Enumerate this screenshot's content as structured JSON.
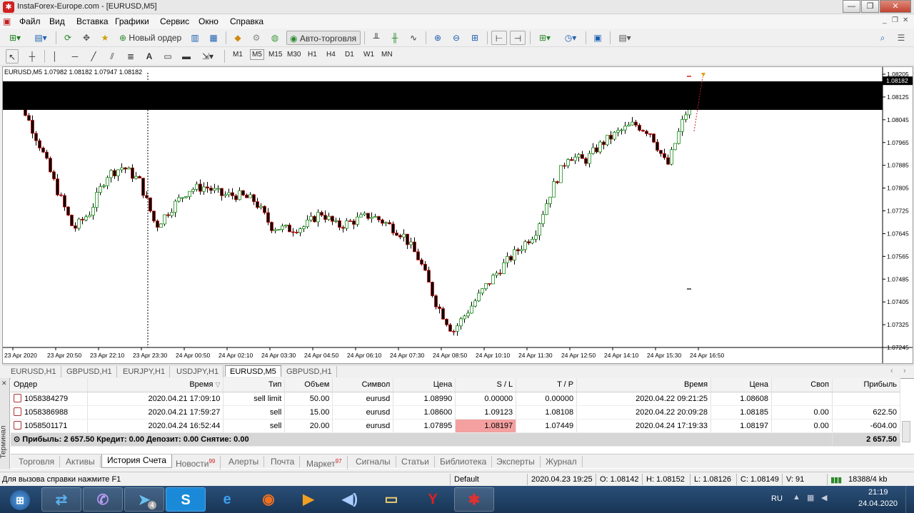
{
  "window": {
    "title": "InstaForex-Europe.com - [EURUSD,M5]",
    "controls": [
      "—",
      "❐",
      "✕"
    ]
  },
  "menu": [
    "Файл",
    "Вид",
    "Вставка",
    "Графики",
    "Сервис",
    "Окно",
    "Справка"
  ],
  "toolbar": {
    "new_order_label": "Новый ордер",
    "auto_trading_label": "Авто-торговля"
  },
  "timeframes": [
    "M1",
    "M5",
    "M15",
    "M30",
    "H1",
    "H4",
    "D1",
    "W1",
    "MN"
  ],
  "chart": {
    "legend": "EURUSD,M5  1.07982 1.08182 1.07947 1.08182",
    "price_label": "1.08182"
  },
  "chart_data": {
    "type": "candlestick",
    "symbol": "EURUSD",
    "timeframe": "M5",
    "ylim": [
      1.07245,
      1.08205
    ],
    "price_ticks": [
      "1.08205",
      "1.08125",
      "1.08045",
      "1.07965",
      "1.07885",
      "1.07805",
      "1.07725",
      "1.07645",
      "1.07565",
      "1.07485",
      "1.07405",
      "1.07325",
      "1.07245"
    ],
    "time_ticks": [
      "23 Apr 2020",
      "23 Apr 20:50",
      "23 Apr 22:10",
      "23 Apr 23:30",
      "24 Apr 00:50",
      "24 Apr 02:10",
      "24 Apr 03:30",
      "24 Apr 04:50",
      "24 Apr 06:10",
      "24 Apr 07:30",
      "24 Apr 08:50",
      "24 Apr 10:10",
      "24 Apr 11:30",
      "24 Apr 12:50",
      "24 Apr 14:10",
      "24 Apr 15:30",
      "24 Apr 16:50"
    ],
    "close_path": [
      1.0817,
      1.0808,
      1.0795,
      1.078,
      1.0766,
      1.0772,
      1.0785,
      1.0788,
      1.0783,
      1.0767,
      1.0774,
      1.078,
      1.0781,
      1.0778,
      1.0778,
      1.0776,
      1.0767,
      1.0766,
      1.0767,
      1.0772,
      1.0767,
      1.0769,
      1.0771,
      1.0768,
      1.0764,
      1.0755,
      1.074,
      1.073,
      1.0738,
      1.0746,
      1.0753,
      1.0759,
      1.0765,
      1.078,
      1.0792,
      1.079,
      1.0796,
      1.08,
      1.0803,
      1.08,
      1.0788,
      1.0805,
      1.0818
    ],
    "current_price": 1.08182
  },
  "symbol_tabs": [
    "EURUSD,H1",
    "GBPUSD,H1",
    "EURJPY,H1",
    "USDJPY,H1",
    "EURUSD,M5",
    "GBPUSD,H1"
  ],
  "active_symbol_tab": "EURUSD,M5",
  "terminal": {
    "side_label": "Терминал",
    "columns": [
      "Ордер",
      "Время",
      "Тип",
      "Объем",
      "Символ",
      "Цена",
      "S / L",
      "T / P",
      "Время",
      "Цена",
      "Своп",
      "Прибыль"
    ],
    "rows": [
      {
        "order": "1058384279",
        "open_time": "2020.04.21 17:09:10",
        "type": "sell limit",
        "volume": "50.00",
        "symbol": "eurusd",
        "price": "1.08990",
        "sl": "0.00000",
        "tp": "0.00000",
        "close_time": "2020.04.22 09:21:25",
        "close_price": "1.08608",
        "swap": "",
        "profit": ""
      },
      {
        "order": "1058386988",
        "open_time": "2020.04.21 17:59:27",
        "type": "sell",
        "volume": "15.00",
        "symbol": "eurusd",
        "price": "1.08600",
        "sl": "1.09123",
        "tp": "1.08108",
        "close_time": "2020.04.22 20:09:28",
        "close_price": "1.08185",
        "swap": "0.00",
        "profit": "622.50"
      },
      {
        "order": "1058501171",
        "open_time": "2020.04.24 16:52:44",
        "type": "sell",
        "volume": "20.00",
        "symbol": "eurusd",
        "price": "1.07895",
        "sl": "1.08197",
        "tp": "1.07449",
        "close_time": "2020.04.24 17:19:33",
        "close_price": "1.08197",
        "swap": "0.00",
        "profit": "-604.00"
      }
    ],
    "summary": "Прибыль: 2 657.50  Кредит: 0.00  Депозит: 0.00  Снятие: 0.00",
    "summary_total": "2 657.50",
    "tabs": [
      "Торговля",
      "Активы",
      "История Счета",
      "Новости",
      "Алерты",
      "Почта",
      "Маркет",
      "Сигналы",
      "Статьи",
      "Библиотека",
      "Эксперты",
      "Журнал"
    ],
    "active_tab": "История Счета",
    "news_badge": "99",
    "market_badge": "97"
  },
  "status": {
    "help": "Для вызова справки нажмите F1",
    "profile": "Default",
    "datetime": "2020.04.23 19:25",
    "open": "O: 1.08142",
    "high": "H: 1.08152",
    "low": "L: 1.08126",
    "close": "C: 1.08149",
    "volume": "V: 91",
    "traffic": "18388/4 kb"
  },
  "taskbar": {
    "lang": "RU",
    "time": "21:19",
    "date": "24.04.2020",
    "apps": [
      "windows-start",
      "teamviewer",
      "viber",
      "telegram",
      "skype",
      "internet-explorer",
      "firefox",
      "media-player",
      "audio",
      "file-explorer",
      "yandex-browser",
      "instaforex-terminal"
    ],
    "telegram_badge": "4"
  },
  "colors": {
    "accent": "#1c6fd0",
    "bull": "#1a8c1a",
    "bear": "#c01010",
    "sl_highlight": "#f4a0a0"
  }
}
